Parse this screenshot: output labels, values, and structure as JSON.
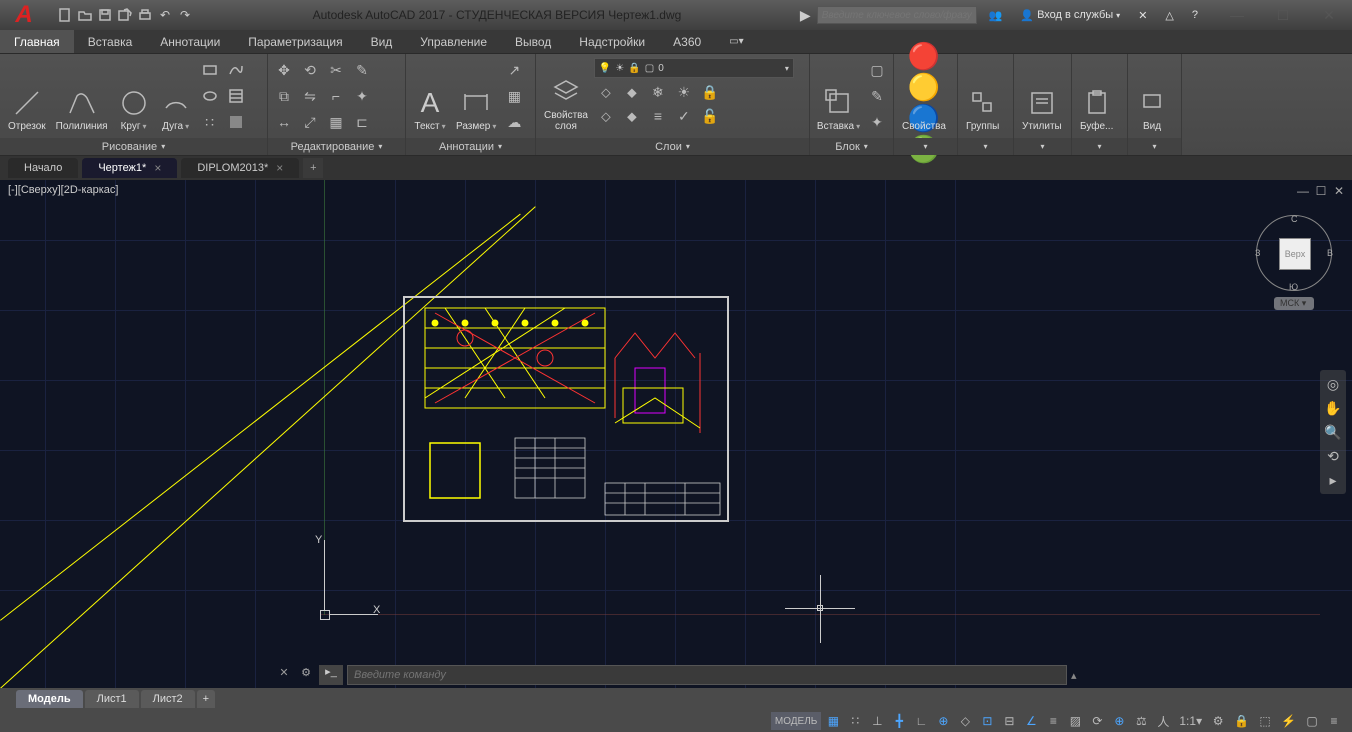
{
  "title": "Autodesk AutoCAD 2017 - СТУДЕНЧЕСКАЯ ВЕРСИЯ Чертеж1.dwg",
  "search_placeholder": "Введите ключевое слово/фразу",
  "signin": "Вход в службы",
  "menu": [
    "Главная",
    "Вставка",
    "Аннотации",
    "Параметризация",
    "Вид",
    "Управление",
    "Вывод",
    "Надстройки",
    "A360"
  ],
  "ribbon": {
    "draw": {
      "title": "Рисование",
      "line": "Отрезок",
      "polyline": "Полилиния",
      "circle": "Круг",
      "arc": "Дуга"
    },
    "modify": {
      "title": "Редактирование"
    },
    "annot": {
      "title": "Аннотации",
      "text": "Текст",
      "dim": "Размер"
    },
    "layers": {
      "title": "Слои",
      "props": "Свойства\nслоя",
      "current": "0"
    },
    "block": {
      "title": "Блок",
      "insert": "Вставка"
    },
    "props": {
      "title": "Свойства"
    },
    "groups": {
      "title": "Группы"
    },
    "utils": {
      "title": "Утилиты"
    },
    "clip": {
      "title": "Буфе..."
    },
    "view": {
      "title": "Вид"
    }
  },
  "file_tabs": {
    "start": "Начало",
    "active": "Чертеж1*",
    "other": "DIPLOM2013*"
  },
  "viewport_label": "[-][Сверху][2D-каркас]",
  "viewcube": {
    "top": "Верх",
    "c": "С",
    "z": "З",
    "v": "В",
    "u": "Ю",
    "wcs": "МСК"
  },
  "axis": {
    "x": "X",
    "y": "Y"
  },
  "cmd_placeholder": "Введите команду",
  "layouts": [
    "Модель",
    "Лист1",
    "Лист2"
  ],
  "status": {
    "model": "МОДЕЛЬ",
    "scale": "1:1"
  }
}
